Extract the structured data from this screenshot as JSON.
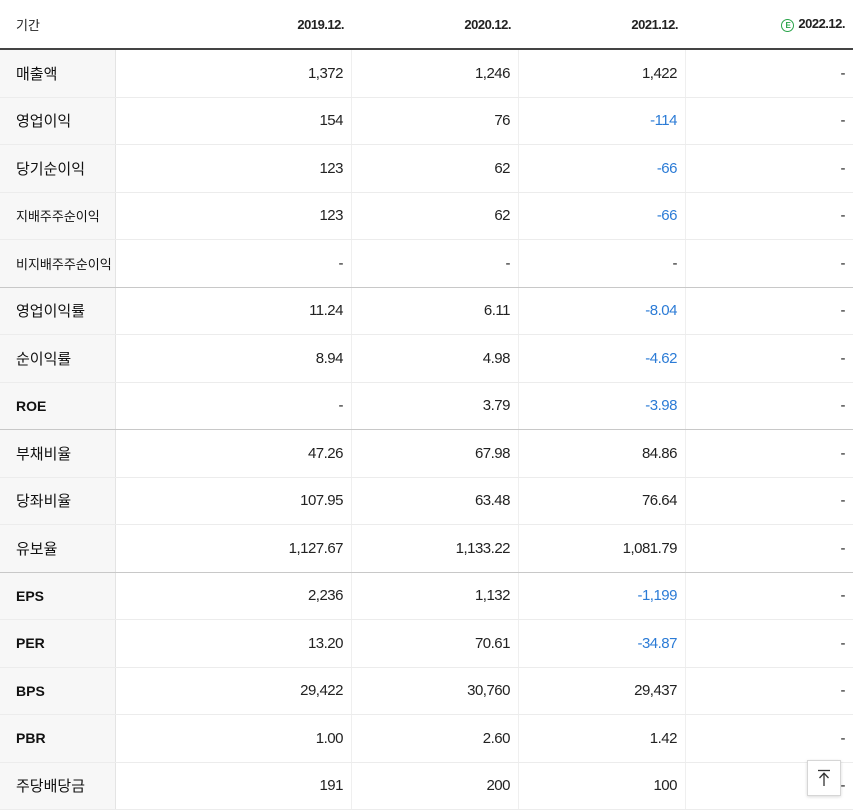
{
  "header": {
    "period_label": "기간",
    "columns": [
      "2019.12.",
      "2020.12.",
      "2021.12.",
      "2022.12."
    ],
    "estimate_mark": "E",
    "estimate_color": "#2aa44a"
  },
  "colors": {
    "negative": "#2b7bd6"
  },
  "rows": [
    {
      "label": "매출액",
      "values": [
        "1,372",
        "1,246",
        "1,422",
        "-"
      ]
    },
    {
      "label": "영업이익",
      "values": [
        "154",
        "76",
        "-114",
        "-"
      ]
    },
    {
      "label": "당기순이익",
      "values": [
        "123",
        "62",
        "-66",
        "-"
      ]
    },
    {
      "label": "지배주주순이익",
      "values": [
        "123",
        "62",
        "-66",
        "-"
      ]
    },
    {
      "label": "비지배주주순이익",
      "values": [
        "-",
        "-",
        "-",
        "-"
      ]
    },
    {
      "label": "영업이익률",
      "values": [
        "11.24",
        "6.11",
        "-8.04",
        "-"
      ]
    },
    {
      "label": "순이익률",
      "values": [
        "8.94",
        "4.98",
        "-4.62",
        "-"
      ]
    },
    {
      "label": "ROE",
      "values": [
        "-",
        "3.79",
        "-3.98",
        "-"
      ]
    },
    {
      "label": "부채비율",
      "values": [
        "47.26",
        "67.98",
        "84.86",
        "-"
      ]
    },
    {
      "label": "당좌비율",
      "values": [
        "107.95",
        "63.48",
        "76.64",
        "-"
      ]
    },
    {
      "label": "유보율",
      "values": [
        "1,127.67",
        "1,133.22",
        "1,081.79",
        "-"
      ]
    },
    {
      "label": "EPS",
      "values": [
        "2,236",
        "1,132",
        "-1,199",
        "-"
      ]
    },
    {
      "label": "PER",
      "values": [
        "13.20",
        "70.61",
        "-34.87",
        "-"
      ]
    },
    {
      "label": "BPS",
      "values": [
        "29,422",
        "30,760",
        "29,437",
        "-"
      ]
    },
    {
      "label": "PBR",
      "values": [
        "1.00",
        "2.60",
        "1.42",
        "-"
      ]
    },
    {
      "label": "주당배당금",
      "values": [
        "191",
        "200",
        "100",
        "-"
      ]
    }
  ],
  "top_button": {
    "icon": "arrow-up-to-top-icon"
  }
}
